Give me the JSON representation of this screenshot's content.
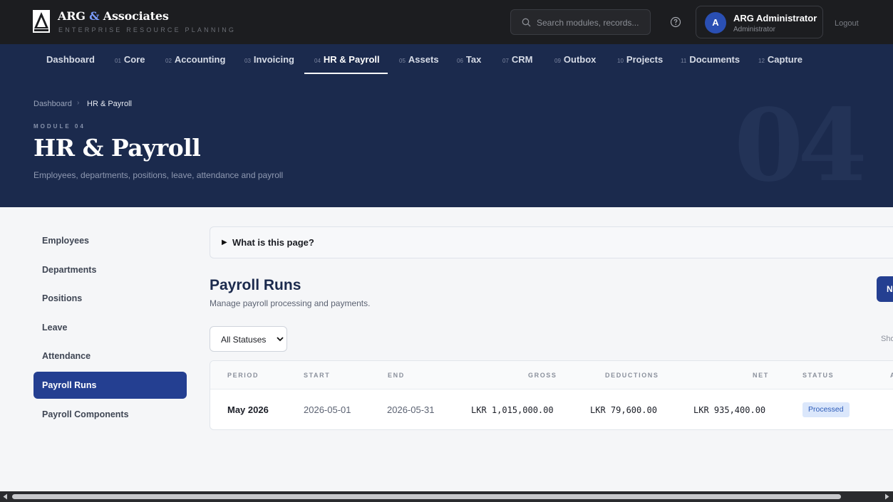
{
  "brand": {
    "name_main": "ARG",
    "name_amp": "&",
    "name_rest": "Associates",
    "subtitle": "ENTERPRISE RESOURCE PLANNING"
  },
  "search": {
    "placeholder": "Search modules, records..."
  },
  "user": {
    "initial": "A",
    "name": "ARG Administrator",
    "role": "Administrator"
  },
  "logout_label": "Logout",
  "nav": [
    {
      "num": "",
      "label": "Dashboard"
    },
    {
      "num": "01",
      "label": "Core"
    },
    {
      "num": "02",
      "label": "Accounting"
    },
    {
      "num": "03",
      "label": "Invoicing"
    },
    {
      "num": "04",
      "label": "HR & Payroll",
      "active": true
    },
    {
      "num": "05",
      "label": "Assets"
    },
    {
      "num": "06",
      "label": "Tax"
    },
    {
      "num": "07",
      "label": "CRM"
    },
    {
      "num": "09",
      "label": "Outbox"
    },
    {
      "num": "10",
      "label": "Projects"
    },
    {
      "num": "11",
      "label": "Documents"
    },
    {
      "num": "12",
      "label": "Capture"
    }
  ],
  "hero": {
    "breadcrumb": [
      "Dashboard",
      "HR & Payroll"
    ],
    "breadcrumb_sep": "›",
    "module_label": "MODULE 04",
    "title": "HR & Payroll",
    "subtitle": "Employees, departments, positions, leave, attendance and payroll",
    "big_number": "04"
  },
  "sidebar": [
    {
      "label": "Employees"
    },
    {
      "label": "Departments"
    },
    {
      "label": "Positions"
    },
    {
      "label": "Leave"
    },
    {
      "label": "Attendance"
    },
    {
      "label": "Payroll Runs",
      "active": true
    },
    {
      "label": "Payroll Components"
    }
  ],
  "faq": {
    "arrow": "▶",
    "label": "What is this page?"
  },
  "page": {
    "title": "Payroll Runs",
    "subtitle": "Manage payroll processing and payments.",
    "new_button": "N",
    "show_label": "Sho"
  },
  "filter": {
    "selected": "All Statuses"
  },
  "table": {
    "headers": [
      "PERIOD",
      "START",
      "END",
      "GROSS",
      "DEDUCTIONS",
      "NET",
      "STATUS",
      "AC"
    ],
    "rows": [
      {
        "period": "May 2026",
        "start": "2026-05-01",
        "end": "2026-05-31",
        "gross": "LKR 1,015,000.00",
        "deductions": "LKR 79,600.00",
        "net": "LKR 935,400.00",
        "status": "Processed"
      }
    ]
  },
  "colors": {
    "topbar": "#1c1d20",
    "navy": "#1b2a4d",
    "accent": "#243f91",
    "badge_bg": "#dbe7fb",
    "badge_fg": "#2c5bb8"
  }
}
